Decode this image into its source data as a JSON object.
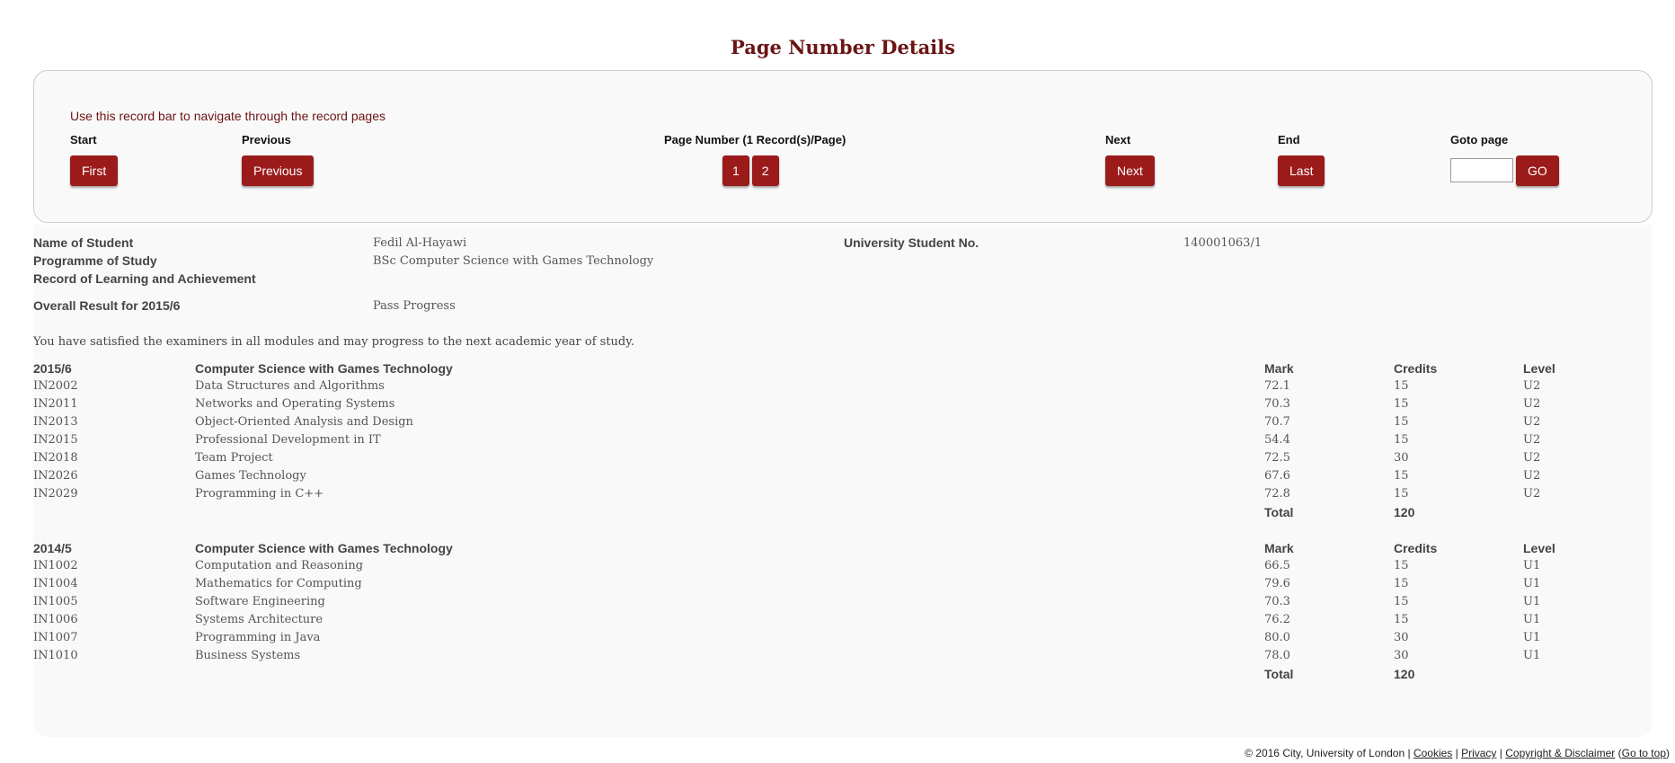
{
  "page_title": "Page Number Details",
  "record_bar": {
    "intro": "Use this record bar to navigate through the record pages",
    "start_label": "Start",
    "first_button": "First",
    "previous_label": "Previous",
    "previous_button": "Previous",
    "page_number_label": "Page Number (1 Record(s)/Page)",
    "pages": [
      "1",
      "2"
    ],
    "next_label": "Next",
    "next_button": "Next",
    "end_label": "End",
    "last_button": "Last",
    "goto_label": "Goto page",
    "goto_value": "",
    "go_button": "GO"
  },
  "student": {
    "name_label": "Name of Student",
    "name_value": "Fedil Al-Hayawi",
    "number_label": "University Student No.",
    "number_value": "140001063/1",
    "programme_label": "Programme of Study",
    "programme_value": "BSc Computer Science with Games Technology",
    "record_label": "Record of Learning and Achievement",
    "result_label": "Overall Result for 2015/6",
    "result_value": "Pass Progress",
    "message": "You have satisfied the examiners in all modules and may progress to the next academic year of study."
  },
  "years": [
    {
      "year": "2015/6",
      "programme": "Computer Science with Games Technology",
      "mark_header": "Mark",
      "credits_header": "Credits",
      "level_header": "Level",
      "modules": [
        {
          "code": "IN2002",
          "title": "Data Structures and Algorithms",
          "mark": "72.1",
          "credits": "15",
          "level": "U2"
        },
        {
          "code": "IN2011",
          "title": "Networks and Operating Systems",
          "mark": "70.3",
          "credits": "15",
          "level": "U2"
        },
        {
          "code": "IN2013",
          "title": "Object-Oriented Analysis and Design",
          "mark": "70.7",
          "credits": "15",
          "level": "U2"
        },
        {
          "code": "IN2015",
          "title": "Professional Development in IT",
          "mark": "54.4",
          "credits": "15",
          "level": "U2"
        },
        {
          "code": "IN2018",
          "title": "Team Project",
          "mark": "72.5",
          "credits": "30",
          "level": "U2"
        },
        {
          "code": "IN2026",
          "title": "Games Technology",
          "mark": "67.6",
          "credits": "15",
          "level": "U2"
        },
        {
          "code": "IN2029",
          "title": "Programming in C++",
          "mark": "72.8",
          "credits": "15",
          "level": "U2"
        }
      ],
      "total_label": "Total",
      "total_credits": "120"
    },
    {
      "year": "2014/5",
      "programme": "Computer Science with Games Technology",
      "mark_header": "Mark",
      "credits_header": "Credits",
      "level_header": "Level",
      "modules": [
        {
          "code": "IN1002",
          "title": "Computation and Reasoning",
          "mark": "66.5",
          "credits": "15",
          "level": "U1"
        },
        {
          "code": "IN1004",
          "title": "Mathematics for Computing",
          "mark": "79.6",
          "credits": "15",
          "level": "U1"
        },
        {
          "code": "IN1005",
          "title": "Software Engineering",
          "mark": "70.3",
          "credits": "15",
          "level": "U1"
        },
        {
          "code": "IN1006",
          "title": "Systems Architecture",
          "mark": "76.2",
          "credits": "15",
          "level": "U1"
        },
        {
          "code": "IN1007",
          "title": "Programming in Java",
          "mark": "80.0",
          "credits": "30",
          "level": "U1"
        },
        {
          "code": "IN1010",
          "title": "Business Systems",
          "mark": "78.0",
          "credits": "30",
          "level": "U1"
        }
      ],
      "total_label": "Total",
      "total_credits": "120"
    }
  ],
  "footer": {
    "copyright": "© 2016 City, University of London | ",
    "cookies": "Cookies",
    "sep1": " | ",
    "privacy": "Privacy",
    "sep2": " | ",
    "disclaimer": "Copyright & Disclaimer",
    "paren_open": " (",
    "go_to_top": "Go to top",
    "paren_close": ")"
  }
}
